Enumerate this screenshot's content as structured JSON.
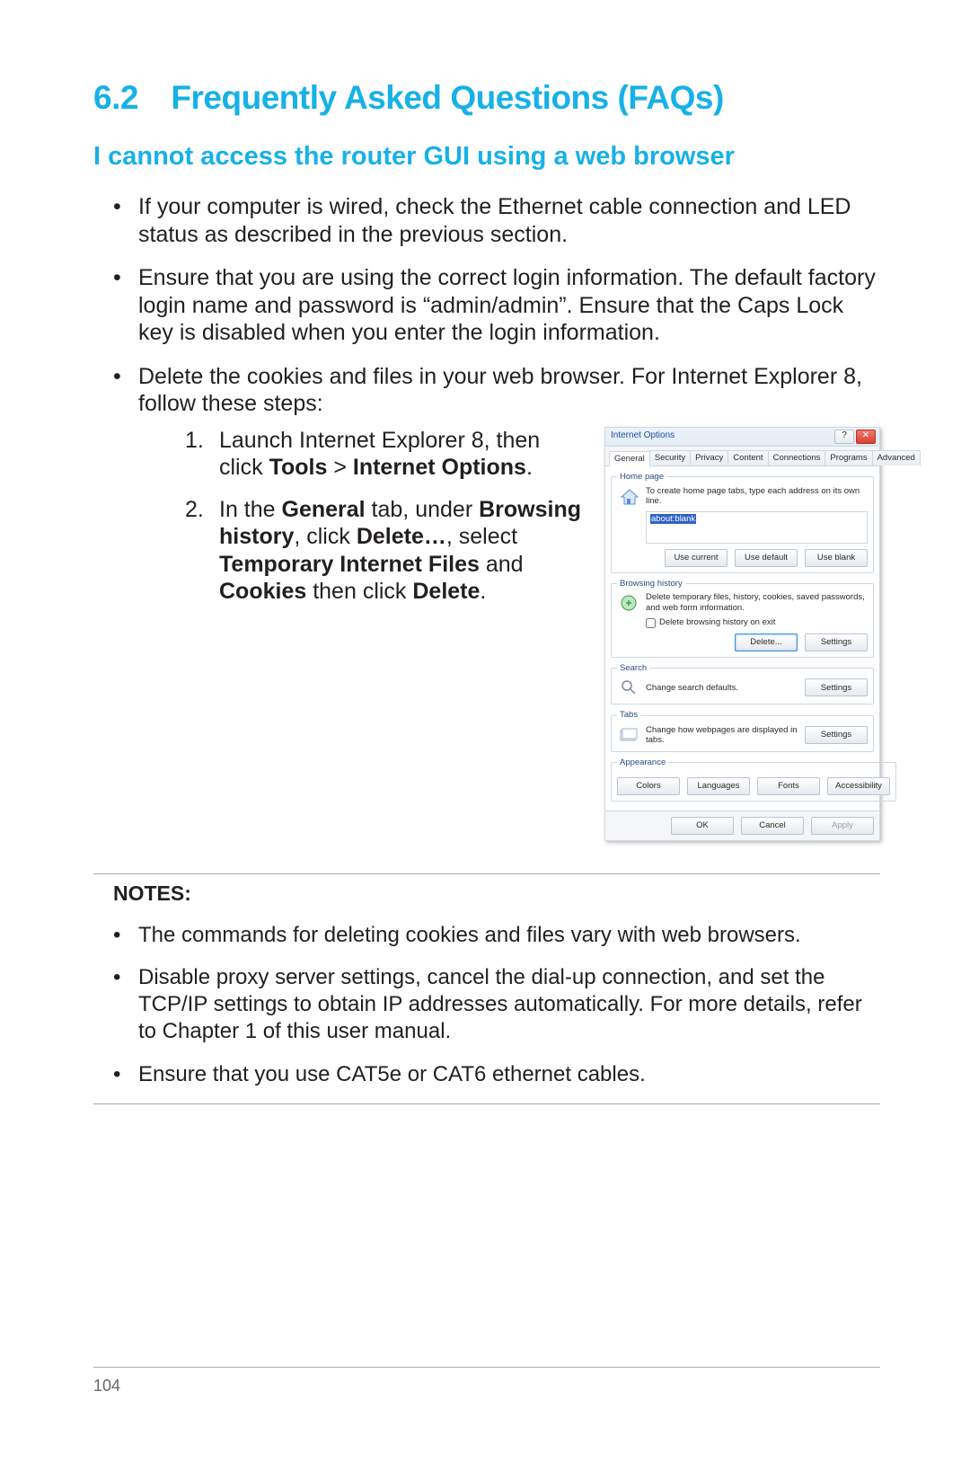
{
  "heading": "6.2 Frequently Asked Questions (FAQs)",
  "subhead": "I cannot access the router GUI using a web browser",
  "bullets": {
    "b1": "If your computer is wired, check the Ethernet cable connection and LED status as described in the previous section.",
    "b2": "Ensure that you are using the correct login information. The default factory login name and password is “admin/admin”. Ensure that the Caps Lock key is disabled when you enter the login information.",
    "b3": "Delete the cookies and files in your web browser. For Internet Explorer 8, follow these steps:"
  },
  "steps": {
    "s1_a": "Launch Internet Explorer 8, then click ",
    "s1_b": "Tools",
    "s1_c": " > ",
    "s1_d": "Internet Options",
    "s1_e": ".",
    "s2_a": "In the ",
    "s2_b": "General",
    "s2_c": " tab, under ",
    "s2_d": "Browsing history",
    "s2_e": ", click ",
    "s2_f": "Delete…",
    "s2_g": ", select ",
    "s2_h": "Temporary Internet Files",
    "s2_i": " and ",
    "s2_j": "Cookies",
    "s2_k": " then click ",
    "s2_l": "Delete",
    "s2_m": "."
  },
  "notes_label": "NOTES:",
  "notes": {
    "n1": "The commands for deleting cookies and files vary with web browsers.",
    "n2": "Disable proxy server settings, cancel the dial-up connection, and set the TCP/IP settings to obtain IP addresses automatically. For more details, refer to Chapter 1 of this user manual.",
    "n3": "Ensure that you use CAT5e or CAT6 ethernet cables."
  },
  "page_number": "104",
  "dialog": {
    "title": "Internet Options",
    "tabs": [
      "General",
      "Security",
      "Privacy",
      "Content",
      "Connections",
      "Programs",
      "Advanced"
    ],
    "active_tab_index": 0,
    "homepage": {
      "legend": "Home page",
      "text": "To create home page tabs, type each address on its own line.",
      "value": "about:blank",
      "buttons": [
        "Use current",
        "Use default",
        "Use blank"
      ]
    },
    "history": {
      "legend": "Browsing history",
      "text": "Delete temporary files, history, cookies, saved passwords, and web form information.",
      "checkbox": "Delete browsing history on exit",
      "buttons": [
        "Delete...",
        "Settings"
      ]
    },
    "search": {
      "legend": "Search",
      "text": "Change search defaults.",
      "button": "Settings"
    },
    "tabs_group": {
      "legend": "Tabs",
      "text": "Change how webpages are displayed in tabs.",
      "button": "Settings"
    },
    "appearance": {
      "legend": "Appearance",
      "buttons": [
        "Colors",
        "Languages",
        "Fonts",
        "Accessibility"
      ]
    },
    "footer": {
      "ok": "OK",
      "cancel": "Cancel",
      "apply": "Apply"
    },
    "help_glyph": "?",
    "close_glyph": "✕"
  }
}
